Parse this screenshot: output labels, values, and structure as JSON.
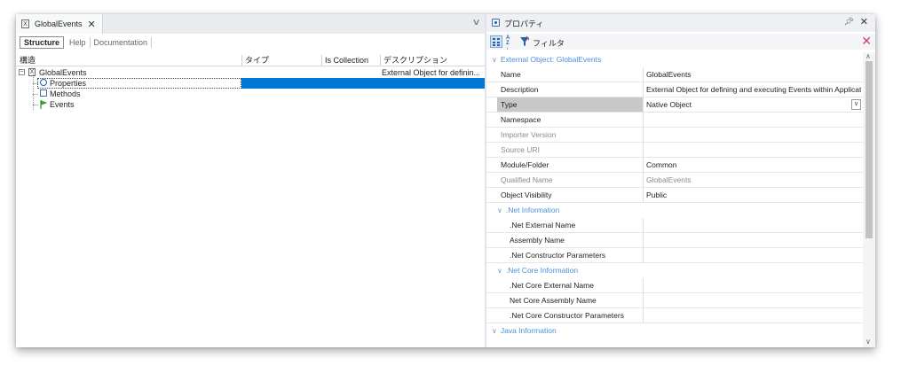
{
  "document_tab": {
    "title": "GlobalEvents"
  },
  "subtabs": [
    "Structure",
    "Help",
    "Documentation"
  ],
  "grid_headers": [
    "構造",
    "タイプ",
    "Is Collection",
    "デスクリプション"
  ],
  "tree": {
    "root": "GlobalEvents",
    "root_description": "External Object for definin...",
    "items": [
      "Properties",
      "Methods",
      "Events"
    ]
  },
  "properties_panel": {
    "title": "プロパティ",
    "filter_label": "フィルタ",
    "category_main": "External Object: GlobalEvents",
    "rows": [
      {
        "name": "Name",
        "value": "GlobalEvents"
      },
      {
        "name": "Description",
        "value": "External Object for defining and executing Events within Applicat..."
      },
      {
        "name": "Type",
        "value": "Native Object"
      },
      {
        "name": "Namespace",
        "value": ""
      },
      {
        "name": "Importer Version",
        "value": ""
      },
      {
        "name": "Source URI",
        "value": ""
      },
      {
        "name": "Module/Folder",
        "value": "Common"
      },
      {
        "name": "Qualified Name",
        "value": "GlobalEvents"
      },
      {
        "name": "Object Visibility",
        "value": "Public"
      }
    ],
    "net_category": ".Net Information",
    "net_rows": [
      {
        "name": ".Net External Name",
        "value": ""
      },
      {
        "name": "Assembly Name",
        "value": ""
      },
      {
        "name": ".Net Constructor Parameters",
        "value": ""
      }
    ],
    "netcore_category": ".Net Core Information",
    "netcore_rows": [
      {
        "name": ".Net Core External Name",
        "value": ""
      },
      {
        "name": "Net Core Assembly Name",
        "value": ""
      },
      {
        "name": ".Net Core Constructor Parameters",
        "value": ""
      }
    ],
    "java_category": "Java Information"
  },
  "colors": {
    "selection": "#0078d4",
    "category_text": "#4a90d9",
    "clear_filter": "#d9397b"
  },
  "icons": [
    "external-object-icon",
    "close-icon",
    "chevron-down-icon",
    "properties-icon",
    "methods-icon",
    "events-flag-icon",
    "pin-icon",
    "categorized-icon",
    "alphabetical-icon",
    "filter-icon",
    "clear-filter-icon"
  ]
}
